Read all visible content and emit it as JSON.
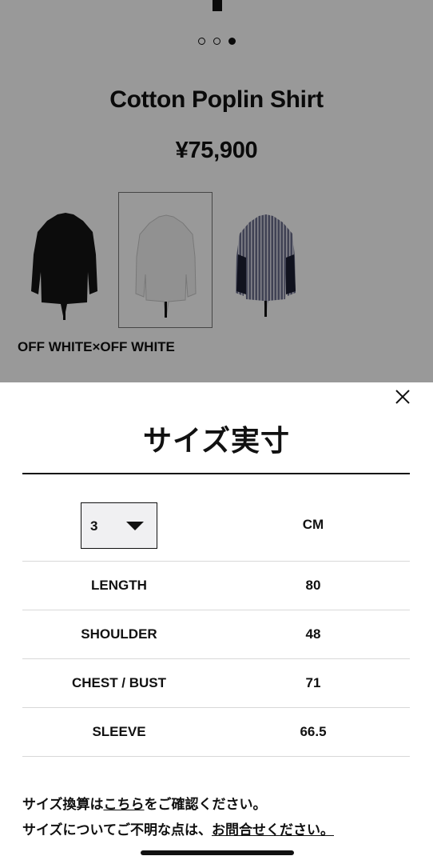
{
  "product": {
    "title": "Cotton Poplin Shirt",
    "price": "¥75,900",
    "color_label": "OFF WHITE×OFF WHITE",
    "carousel": {
      "total": 3,
      "active": 3
    },
    "swatches": [
      {
        "color": "#141414",
        "selected": false
      },
      {
        "color": "#f2f2f2",
        "selected": true
      },
      {
        "color": "#4a4d6a",
        "selected": false
      }
    ]
  },
  "sheet": {
    "title": "サイズ実寸",
    "size_selected": "3",
    "unit": "CM",
    "rows": [
      {
        "label": "LENGTH",
        "value": "80"
      },
      {
        "label": "SHOULDER",
        "value": "48"
      },
      {
        "label": "CHEST / BUST",
        "value": "71"
      },
      {
        "label": "SLEEVE",
        "value": "66.5"
      }
    ],
    "note1": {
      "pre": "サイズ換算は",
      "link": "こちら",
      "post": "をご確認ください。"
    },
    "note2": {
      "pre": "サイズについてご不明な点は、",
      "link": "お問合せください。"
    }
  },
  "icons": {
    "close": "close-icon",
    "caret": "chevron-down-icon"
  }
}
